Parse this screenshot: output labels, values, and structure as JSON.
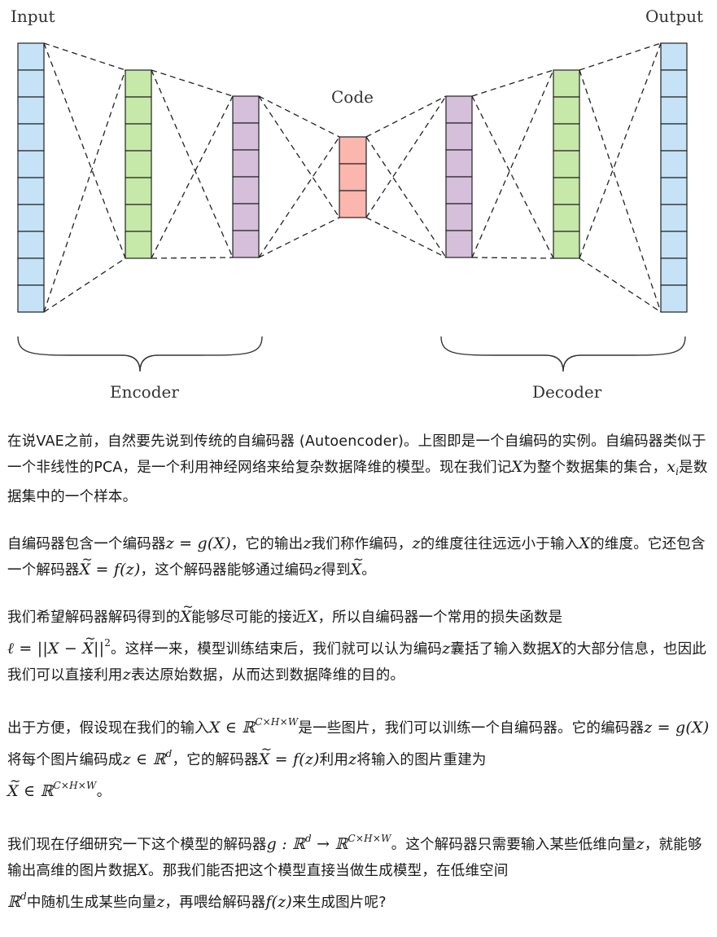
{
  "diagram": {
    "labels": {
      "input": "Input",
      "output": "Output",
      "code": "Code",
      "encoder": "Encoder",
      "decoder": "Decoder"
    },
    "colors": {
      "input_output": "#c5e2f6",
      "layer2": "#c6e8a9",
      "layer3": "#d6bfdb",
      "code": "#fbb6ae",
      "stroke": "#222222"
    },
    "layers": [
      {
        "name": "input-layer",
        "units": 10,
        "color": "input_output"
      },
      {
        "name": "encoder-hidden-1",
        "units": 7,
        "color": "layer2"
      },
      {
        "name": "encoder-hidden-2",
        "units": 6,
        "color": "layer3"
      },
      {
        "name": "code-layer",
        "units": 3,
        "color": "code"
      },
      {
        "name": "decoder-hidden-1",
        "units": 6,
        "color": "layer3"
      },
      {
        "name": "decoder-hidden-2",
        "units": 7,
        "color": "layer2"
      },
      {
        "name": "output-layer",
        "units": 10,
        "color": "input_output"
      }
    ]
  },
  "article": {
    "p1": {
      "a": "在说VAE之前，自然要先说到传统的自编码器 (Autoencoder)。上图即是一个自编码的实例。自编码器类似于一个非线性的PCA，是一个利用神经网络来给复杂数据降维的模型。现在我们记",
      "X": "X",
      "b": "为整个数据集的集合，",
      "x": "x",
      "i": "i",
      "c": "是数据集中的一个样本。"
    },
    "p2": {
      "a": "自编码器包含一个编码器",
      "eq1": "z = g(X)",
      "b": "，它的输出",
      "z1": "z",
      "c": "我们称作编码，",
      "z2": "z",
      "d": "的维度往往远远小于输入",
      "X": "X",
      "e": "的维度。它还包含一个解码器",
      "Xt": "X",
      "eq2": " = f(z)",
      "f": "，这个解码器能够通过编码",
      "z3": "z",
      "g": "得到",
      "Xt2": "X",
      "h": "。"
    },
    "p3": {
      "a": "我们希望解码器解码得到的",
      "Xt": "X",
      "b": "能够尽可能的接近",
      "X": "X",
      "c": "，所以自编码器一个常用的损失函数是",
      "loss_a": "ℓ = ||X − ",
      "loss_Xt": "X",
      "loss_b": "||",
      "loss_exp": "2",
      "d": "。这样一来，模型训练结束后，我们就可以认为编码",
      "z1": "z",
      "e": "囊括了输入数据",
      "X2": "X",
      "f": "的大部分信息，也因此我们可以直接利用",
      "z2": "z",
      "g": "表达原始数据，从而达到数据降维的目的。"
    },
    "p4": {
      "a": "出于方便，假设现在我们的输入",
      "eq1": "X ∈ ℝ",
      "exp1": "C×H×W",
      "b": "是一些图片，我们可以训练一个自编码器。它的编码器",
      "eq2": "z = g(X)",
      "c": "将每个图片编码成",
      "eq3": "z ∈ ℝ",
      "exp3": "d",
      "d": "，它的解码器",
      "Xt": "X",
      "eq4": " = f(z)",
      "e": "利用",
      "z": "z",
      "f": "将输入的图片重建为",
      "Xt2": "X",
      "eq5": " ∈ ℝ",
      "exp5": "C×H×W",
      "g": "。"
    },
    "p5": {
      "a": "我们现在仔细研究一下这个模型的解码器",
      "eq1": "g : ℝ",
      "exp1": "d",
      "arrow": " → ℝ",
      "exp2": "C×H×W",
      "b": "。这个解码器只需要输入某些低维向量",
      "z1": "z",
      "c": "，就能够输出高维的图片数据",
      "X": "X",
      "d": "。那我们能否把这个模型直接当做生成模型，在低维空间",
      "R": "ℝ",
      "exp3": "d",
      "e": "中随机生成某些向量",
      "z2": "z",
      "f": "，再喂给解码器",
      "eq2": "f(z)",
      "g": "来生成图片呢?"
    }
  }
}
